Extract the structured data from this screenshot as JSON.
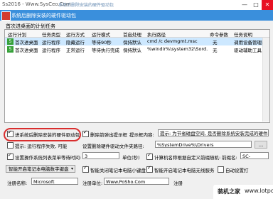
{
  "window": {
    "title": "Ss2016 - Www.SysCeo.Com",
    "watermark": "系统后删除安装的硬件驱动包",
    "min_glyph": "—",
    "max_glyph": "□",
    "close_glyph": "✕",
    "banner_title": "系统后删除安装的硬件驱动包"
  },
  "group_label": "首次进桌面的计划任务",
  "table": {
    "columns": [
      "运行计划",
      "任务类型",
      "运行方式",
      "运行模式",
      "首启处理",
      "执行路径",
      "命令参数",
      "任务说明"
    ],
    "rows": [
      {
        "num": "5",
        "cells": [
          "首次进桌面",
          "运行程序",
          "隐藏运行",
          "等待90秒",
          "保持默认",
          "cmd /c devmgmt.msc",
          "无",
          "调用设备管理器"
        ],
        "selected": true
      },
      {
        "num": "5",
        "cells": [
          "首次进桌面",
          "运行程序",
          "正常运行",
          "等待执行完成",
          "保持默认",
          "%windir%\\system32\\Sord...",
          "无",
          "驱动辅助工具"
        ],
        "selected": false
      }
    ]
  },
  "options": {
    "delete_driver_pkg": {
      "label": "进系统后删除安装的硬件驱动包",
      "checked": true
    },
    "delete_before_hint": {
      "label": "删除前弹出提示框",
      "checked": true
    },
    "hint_content_label": "提示框内容:",
    "hint_content_value": "提示: 为节省磁盘空间, 是否删除系统安装完成的硬件驱动",
    "hint_failed": {
      "label": "提示: 运行程序失败, 可能",
      "checked": false
    },
    "driver_folder_label": "设置删除硬件驱动文件夹路径:",
    "driver_folder_value": "%SystemDrive%\\Drivers",
    "dots": "...",
    "wait_time": {
      "label": "设置操作系统列表菜单等待时间:",
      "value": "3",
      "unit": "单位(秒)",
      "checked": true
    },
    "computer_name": {
      "label": "计算机名称根据自定义前缀随机:",
      "checked": true
    },
    "prefix_label": "前缀名:",
    "prefix_value": "SC-",
    "smart_open": {
      "selected": "智能开启笔记本电脑数字键盘",
      "arrow": "▾"
    },
    "smart_close_keypad": {
      "label": "智能关闭笔记本电脑小键盘",
      "checked": true
    },
    "smart_wireless": {
      "label": "智能开启笔记本电脑无线服务",
      "checked": true
    },
    "auto_restart": {
      "label": "自动设置打",
      "checked": false
    },
    "reg_name_label": "注册名称:",
    "reg_name_value": "Microsoft",
    "reg_unit_label": "注册单位:",
    "reg_unit_value": "Www.PoSho.Com",
    "reg_extra_label": "注册"
  },
  "logo": {
    "part1": "装机之家",
    "part2": "www.lotpc.com"
  }
}
